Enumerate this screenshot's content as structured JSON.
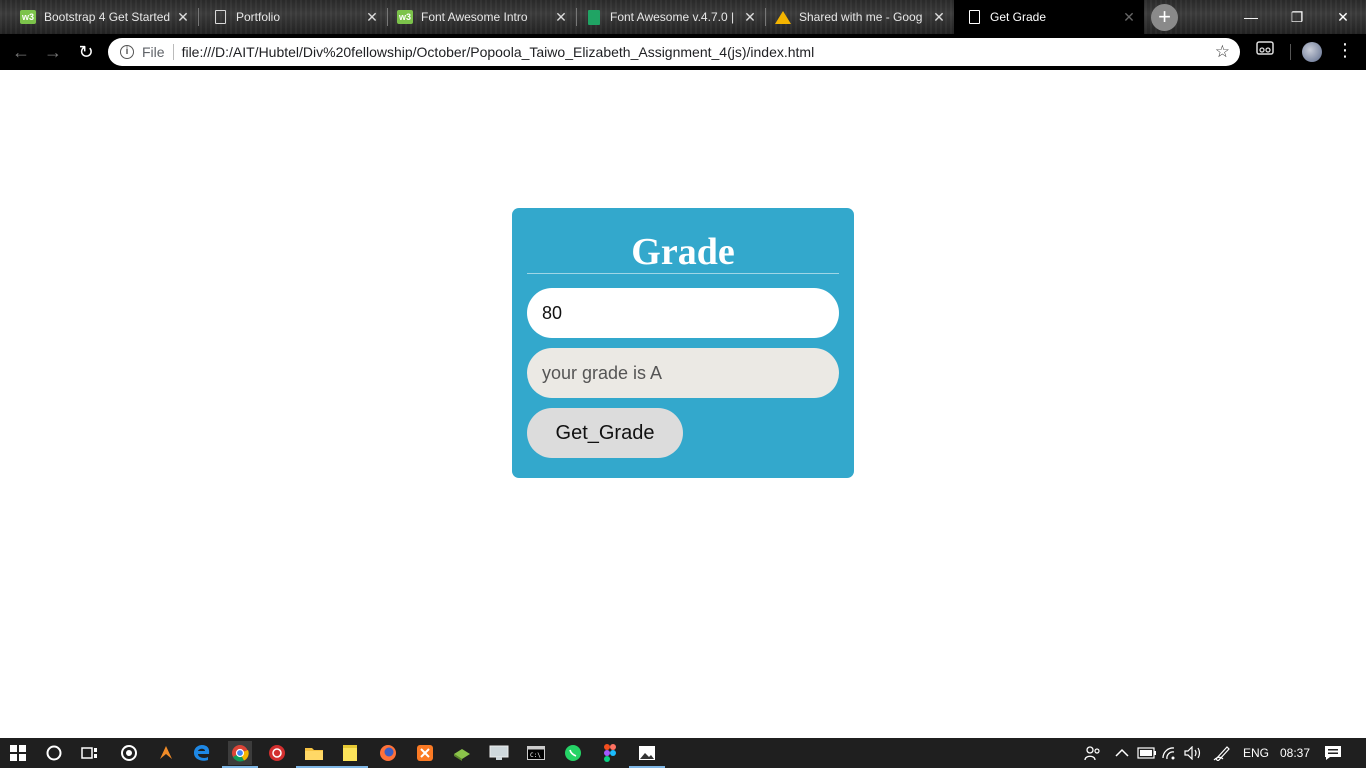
{
  "browser": {
    "tabs": [
      {
        "title": "Bootstrap 4 Get Started",
        "favicon": "w3schools-icon",
        "active": false
      },
      {
        "title": "Portfolio",
        "favicon": "page-icon",
        "active": false
      },
      {
        "title": "Font Awesome Intro",
        "favicon": "w3schools-icon",
        "active": false
      },
      {
        "title": "Font Awesome v.4.7.0 |",
        "favicon": "sheets-icon",
        "active": false
      },
      {
        "title": "Shared with me - Goog",
        "favicon": "drive-icon",
        "active": false
      },
      {
        "title": "Get Grade",
        "favicon": "page-icon",
        "active": true
      }
    ],
    "w3_label": "w3",
    "new_tab_symbol": "+",
    "window_controls": {
      "minimize": "—",
      "restore": "❐",
      "close": "✕"
    },
    "toolbar": {
      "back_symbol": "←",
      "forward_symbol": "→",
      "reload_symbol": "↻",
      "info_symbol": "i",
      "scheme_label": "File",
      "url": "file:///D:/AIT/Hubtel/Div%20fellowship/October/Popoola_Taiwo_Elizabeth_Assignment_4(js)/index.html",
      "star_symbol": "☆",
      "menu_symbol": "⋮"
    }
  },
  "page": {
    "card_title": "Grade",
    "score_value": "80",
    "result_text": "your grade is A",
    "button_label": "Get_Grade",
    "card_color": "#33a8cc"
  },
  "taskbar": {
    "language": "ENG",
    "time": "08:37"
  }
}
